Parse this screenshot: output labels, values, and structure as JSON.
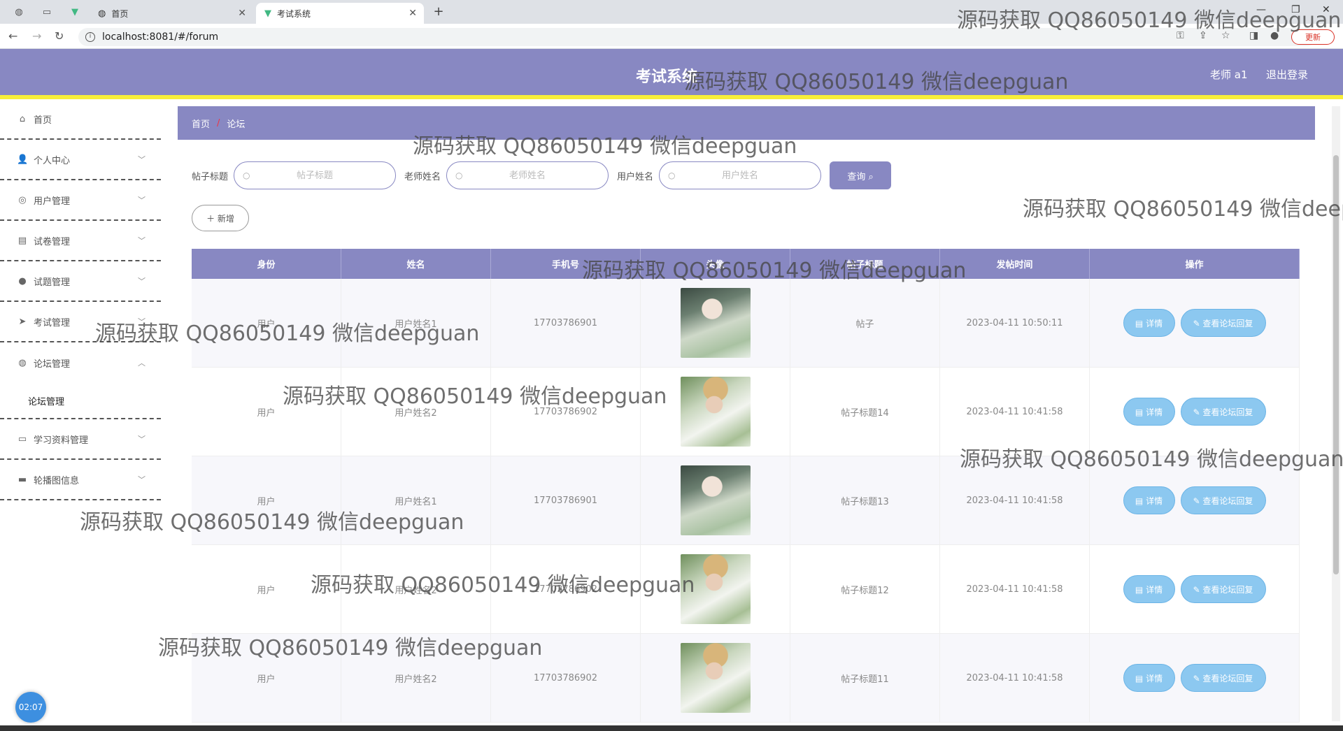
{
  "browser": {
    "tabs": [
      {
        "label": "首页",
        "active": false
      },
      {
        "label": "考试系统",
        "active": true
      }
    ],
    "url": "localhost:8081/#/forum",
    "update_label": "更新"
  },
  "header": {
    "title": "考试系统",
    "user": "老师 a1",
    "logout": "退出登录"
  },
  "sidebar": {
    "items": [
      {
        "label": "首页",
        "icon": "home-icon",
        "glyph": "⌂"
      },
      {
        "label": "个人中心",
        "icon": "user-icon",
        "glyph": "👤"
      },
      {
        "label": "用户管理",
        "icon": "users-icon",
        "glyph": "◎"
      },
      {
        "label": "试卷管理",
        "icon": "paper-icon",
        "glyph": "▤"
      },
      {
        "label": "试题管理",
        "icon": "question-icon",
        "glyph": "●"
      },
      {
        "label": "考试管理",
        "icon": "send-icon",
        "glyph": "➤"
      },
      {
        "label": "论坛管理",
        "icon": "forum-icon",
        "glyph": "◍"
      },
      {
        "label": "学习资料管理",
        "icon": "material-icon",
        "glyph": "▭"
      },
      {
        "label": "轮播图信息",
        "icon": "carousel-icon",
        "glyph": "▬"
      }
    ],
    "submenu": {
      "label": "论坛管理"
    },
    "clock": "02:07"
  },
  "breadcrumb": {
    "home": "首页",
    "sep": "/",
    "current": "论坛"
  },
  "search": {
    "title_label": "帖子标题",
    "title_placeholder": "帖子标题",
    "teacher_label": "老师姓名",
    "teacher_placeholder": "老师姓名",
    "user_label": "用户姓名",
    "user_placeholder": "用户姓名",
    "query_button": "查询 ⌕"
  },
  "add_button": "＋ 新增",
  "table": {
    "headers": [
      "身份",
      "姓名",
      "手机号",
      "头像",
      "帖子标题",
      "发帖时间",
      "操作"
    ],
    "detail_label": "▤ 详情",
    "reply_label": "✎ 查看论坛回复",
    "rows": [
      {
        "role": "用户",
        "name": "用户姓名1",
        "phone": "17703786901",
        "avatar": "a",
        "title": "帖子",
        "time": "2023-04-11 10:50:11"
      },
      {
        "role": "用户",
        "name": "用户姓名2",
        "phone": "17703786902",
        "avatar": "b",
        "title": "帖子标题14",
        "time": "2023-04-11 10:41:58"
      },
      {
        "role": "用户",
        "name": "用户姓名1",
        "phone": "17703786901",
        "avatar": "a",
        "title": "帖子标题13",
        "time": "2023-04-11 10:41:58"
      },
      {
        "role": "用户",
        "name": "用户姓名2",
        "phone": "17703786902",
        "avatar": "b",
        "title": "帖子标题12",
        "time": "2023-04-11 10:41:58"
      },
      {
        "role": "用户",
        "name": "用户姓名2",
        "phone": "17703786902",
        "avatar": "b",
        "title": "帖子标题11",
        "time": "2023-04-11 10:41:58"
      }
    ]
  },
  "watermark": "源码获取 QQ86050149 微信deepguan"
}
